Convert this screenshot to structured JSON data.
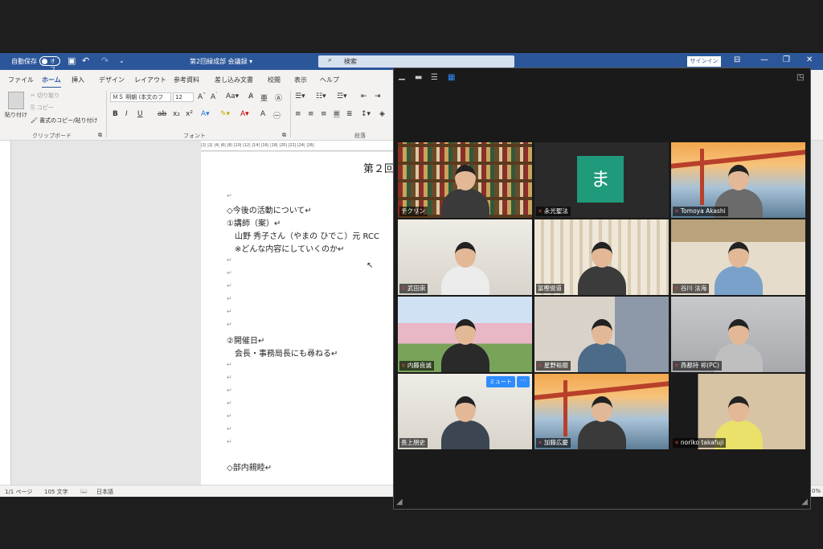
{
  "word": {
    "titlebar": {
      "autosave_label": "自動保存",
      "autosave_state": "オフ",
      "doc_title": "第2回緑成部 会議録 ▾",
      "search_placeholder": "検索",
      "signin_label": "サインイン"
    },
    "ribbon_tabs": [
      "ファイル",
      "ホーム",
      "挿入",
      "デザイン",
      "レイアウト",
      "参考資料",
      "差し込み文書",
      "校閲",
      "表示",
      "ヘルプ"
    ],
    "clipboard": {
      "paste": "貼り付け",
      "cut": "切り取り",
      "copy": "コピー",
      "format_painter": "書式のコピー/貼り付け",
      "group_label": "クリップボード"
    },
    "font": {
      "font_name": "ＭＳ 明朝 (本文のフ",
      "font_size": "12",
      "group_label": "フォント"
    },
    "paragraph": {
      "group_label": "段落"
    },
    "ruler_text": "|2|  |2|  |4|  |6|  |8|  |10|  |12|  |14|  |16|  |18|  |20|  |22|  |24|  |26|",
    "document": {
      "heading": "第２回",
      "lines": [
        "◇今後の活動について↵",
        "①講師（案）↵",
        "山野 秀子さん（やまの ひでこ）元 RCC",
        "※どんな内容にしていくのか↵",
        "②開催日↵",
        "会長・事務局長にも尋ねる↵",
        "◇部内親睦↵"
      ],
      "pilcrow": "↵"
    },
    "status": {
      "page": "1/1 ページ",
      "words": "105 文字",
      "language": "日本語",
      "zoom_fragment": "0%"
    }
  },
  "zoom": {
    "view_controls": [
      "minimize",
      "single",
      "split",
      "gallery"
    ],
    "mute_button_label": "ミュート",
    "more_button_label": "···",
    "participants": [
      {
        "name": "チクリン",
        "muted": false,
        "scene": "shelves",
        "avatar": ""
      },
      {
        "name": "永光聖法",
        "muted": true,
        "scene": "avatar",
        "avatar": "ま"
      },
      {
        "name": "Tomoya Akashi",
        "muted": true,
        "scene": "bridge",
        "avatar": ""
      },
      {
        "name": "武田崇",
        "muted": true,
        "scene": "room-white",
        "avatar": ""
      },
      {
        "name": "冨樫俊道",
        "muted": false,
        "scene": "room-curtain",
        "avatar": ""
      },
      {
        "name": "谷川 法海",
        "muted": true,
        "scene": "room-japanese",
        "avatar": ""
      },
      {
        "name": "内藤良诚",
        "muted": true,
        "scene": "cherry",
        "avatar": ""
      },
      {
        "name": "星野裕樹",
        "muted": true,
        "scene": "room-window",
        "avatar": ""
      },
      {
        "name": "燕都持 祢(PC)",
        "muted": true,
        "scene": "room-grey",
        "avatar": ""
      },
      {
        "name": "長上朋史",
        "muted": false,
        "scene": "room-white",
        "avatar": "",
        "speaking": true
      },
      {
        "name": "加藤広慶",
        "muted": true,
        "scene": "bridge",
        "avatar": ""
      },
      {
        "name": "noriko takafuji",
        "muted": true,
        "scene": "room-dark",
        "avatar": ""
      }
    ]
  }
}
